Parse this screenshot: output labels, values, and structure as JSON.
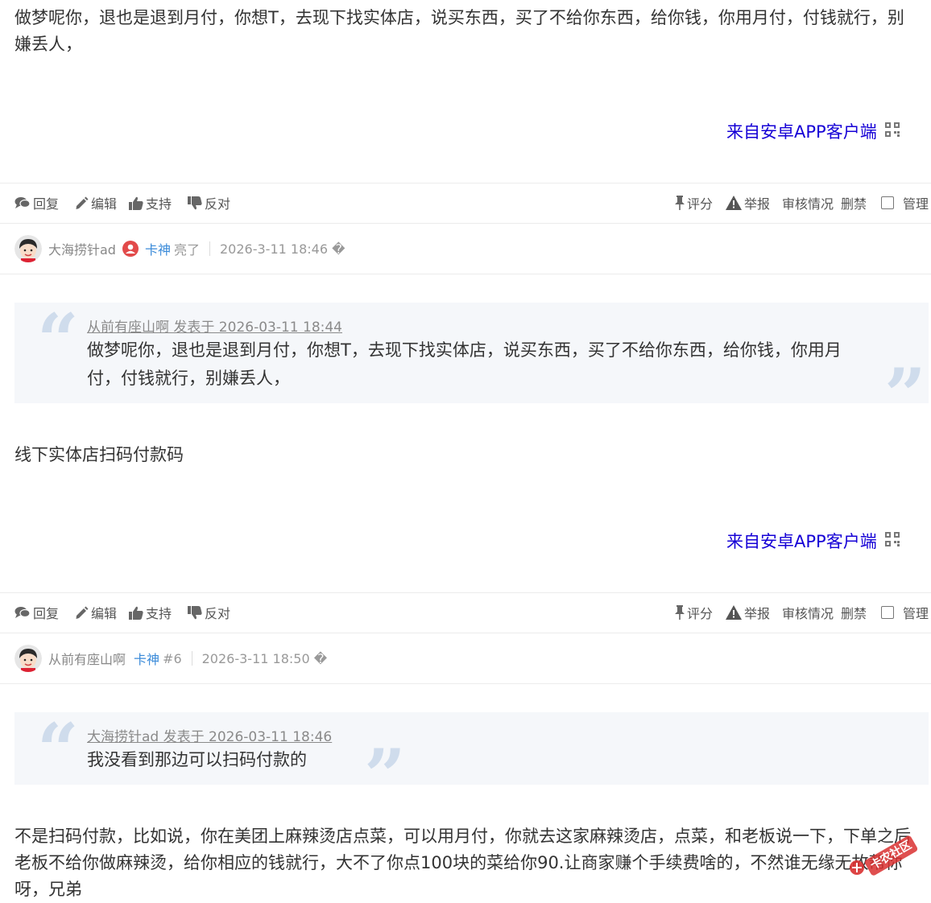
{
  "posts": [
    {
      "body": "做梦呢你，退也是退到月付，你想T，去现下找实体店，说买东西，买了不给你东西，给你钱，你用月付，付钱就行，别嫌丢人，",
      "source": "来自安卓APP客户端"
    },
    {
      "author": "大海捞针ad",
      "badge": "卡神",
      "status": "亮了",
      "time": "2026-3-11 18:46 �",
      "quote_head": "从前有座山啊 发表于 2026-03-11 18:44",
      "quote_text": "做梦呢你，退也是退到月付，你想T，去现下找实体店，说买东西，买了不给你东西，给你钱，你用月付，付钱就行，别嫌丢人，",
      "body": "线下实体店扫码付款码",
      "source": "来自安卓APP客户端"
    },
    {
      "author": "从前有座山啊",
      "badge": "卡神",
      "floor": "#6",
      "time": "2026-3-11 18:50 �",
      "quote_head": "大海捞针ad 发表于 2026-03-11 18:46",
      "quote_text": "我没看到那边可以扫码付款的",
      "body": "不是扫码付款，比如说，你在美团上麻辣烫店点菜，可以用月付，你就去这家麻辣烫店，点菜，和老板说一下，下单之后老板不给你做麻辣烫，给你相应的钱就行，大不了你点100块的菜给你90.让商家赚个手续费啥的，不然谁无缘无故帮你呀，兄弟"
    }
  ],
  "actions": {
    "reply": "回复",
    "edit": "编辑",
    "support": "支持",
    "oppose": "反对",
    "rate": "评分",
    "report": "举报",
    "review": "审核情况",
    "ban": "删禁",
    "manage": "管理"
  },
  "watermark": "卡农社区",
  "colors": {
    "link": "#1500d6",
    "badge": "#3b8bd9",
    "quote_bg": "#f5f7fa",
    "quote_mark": "#cfdcec"
  }
}
